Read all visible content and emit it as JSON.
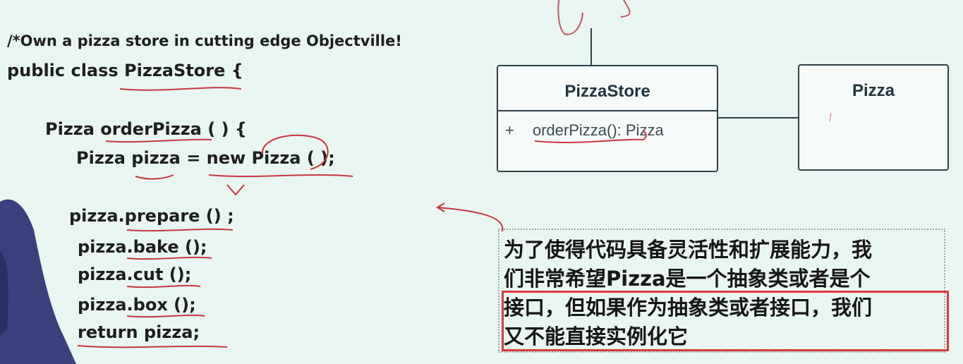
{
  "code": {
    "comment": "/*Own a pizza store in cutting edge Objectville!",
    "class_decl": "public class PizzaStore {",
    "method_decl": "Pizza orderPizza ( ) {",
    "new_line": "Pizza pizza = new Pizza ( );",
    "prepare": "pizza.prepare () ;",
    "bake": "pizza.bake ();",
    "cut": "pizza.cut ();",
    "box": "pizza.box ();",
    "return": "return pizza;"
  },
  "uml": {
    "store_class": "PizzaStore",
    "visibility": "+",
    "operation": "orderPizza(): Pizza",
    "pizza_class": "Pizza"
  },
  "note": {
    "lines": [
      "为了使得代码具备灵活性和扩展能力，我",
      "们非常希望Pizza是一个抽象类或者是个",
      "接口，但如果作为抽象类或者接口，我们",
      "又不能直接实例化它"
    ]
  },
  "colors": {
    "background": "#e9f5f1",
    "annotation_red": "#d83a3a",
    "text": "#1e1e1e"
  }
}
